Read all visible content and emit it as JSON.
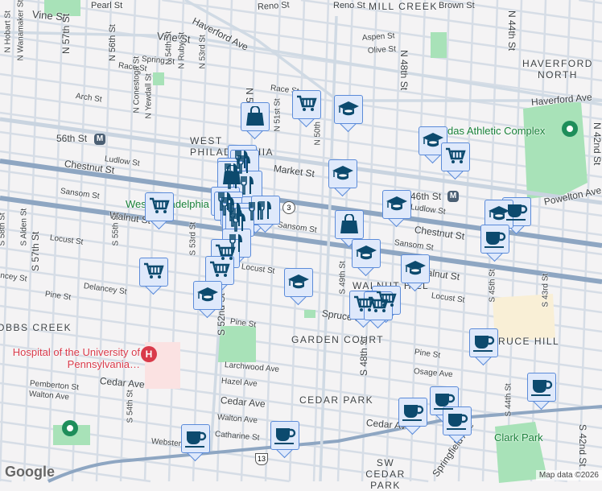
{
  "streets": {
    "vine1": "Vine St",
    "vine2": "Vine St",
    "pearl": "Pearl St",
    "reno": "Reno St",
    "reno2": "Reno St",
    "haverford": "Haverford Ave",
    "haverford2": "Haverford Ave",
    "n52": "N 52nd St",
    "n57": "N 57th St",
    "n56": "N 56th St",
    "nhobart": "N Hobart St",
    "nwanamaker": "N Wanamaker St",
    "spring": "Spring St",
    "race": "Race St",
    "race2": "Race St",
    "n54": "N 54th St",
    "nruby": "N Ruby St",
    "n53": "N 53rd St",
    "arch": "Arch St",
    "nconestoga": "N Conestoga St",
    "nyewdall": "N Yewdall St",
    "ludlow": "Ludlow St",
    "ludlow2": "Ludlow St",
    "chestnut": "Chestnut St",
    "chestnut2": "Chestnut St",
    "sansom": "Sansom St",
    "sansom2": "Sansom St",
    "sansom3": "Sansom St",
    "market": "Market St",
    "walnut": "Walnut St",
    "walnut2": "Walnut St",
    "locust": "Locust St",
    "locust2": "Locust St",
    "locust3": "Locust St",
    "delancey": "Delancey St",
    "delancey2": "Delancey St",
    "pine": "Pine St",
    "pine2": "Pine St",
    "pine3": "Pine St",
    "s58": "S 58th St",
    "salden": "S Alden St",
    "s57": "S 57th St",
    "s55": "S 55th St",
    "s54": "S 54th St",
    "s53": "S 53rd St",
    "s52": "S 52nd St",
    "s49": "S 49th St",
    "s48": "S 48th St",
    "s45": "S 45th St",
    "s44": "S 44th St",
    "s43": "S 43rd St",
    "s42": "S 42nd St",
    "n51": "N 51st St",
    "n50": "N 50th St",
    "n48": "N 48th St",
    "n44": "N 44th St",
    "n42": "N 42nd St",
    "aspen": "Aspen St",
    "olive": "Olive St",
    "brown": "Brown St",
    "powelton": "Powelton Ave",
    "spruce": "Spruce St",
    "larchwood": "Larchwood Ave",
    "hazel": "Hazel Ave",
    "cedar1": "Cedar Ave",
    "cedar2": "Cedar Ave",
    "cedar3": "Cedar Ave",
    "pemberton": "Pemberton St",
    "walton": "Walton Ave",
    "walton2": "Walton Ave",
    "catharine": "Catharine St",
    "webster": "Webster St",
    "osage": "Osage Ave",
    "springfield": "Springfield Ave"
  },
  "neighborhoods": {
    "mill_creek": "MILL CREEK",
    "haverford_north": "HAVERFORD NORTH",
    "west_phila": "WEST PHILADELPHIA",
    "walnut_hill": "WALNUT HILL",
    "garden_court": "GARDEN COURT",
    "cobbs_creek": "COBBS CREEK",
    "cedar_park": "CEDAR PARK",
    "spruce_hill": "SPRUCE HILL",
    "sw_cedar_park": "SW CEDAR PARK"
  },
  "places": {
    "athletic": "Sayre Athletic Complex",
    "athletic_visible": "das Athletic Complex",
    "west_phila_visible": "West Philadelphia",
    "hospital": "Hospital of the University of Pennsylvania…",
    "clark_park": "Clark Park",
    "station_56": "56th St",
    "station_46": "46th St"
  },
  "route_shields": {
    "r3": "3",
    "r13": "13"
  },
  "attribution": {
    "logo": "Google",
    "map_data": "Map data ©2026"
  },
  "marker_types": {
    "grocery": "cart-icon",
    "education": "graduation-cap-icon",
    "shopping": "shopping-bag-icon",
    "restaurant": "fork-knife-icon",
    "cafe": "coffee-cup-icon"
  },
  "colors": {
    "marker_bg": "#dfe9fb",
    "marker_border": "#5b8bd9",
    "icon": "#0c4a6e",
    "major_road": "#8ea6c2",
    "park": "#a8e2b8",
    "hospital": "#d93a4a"
  }
}
